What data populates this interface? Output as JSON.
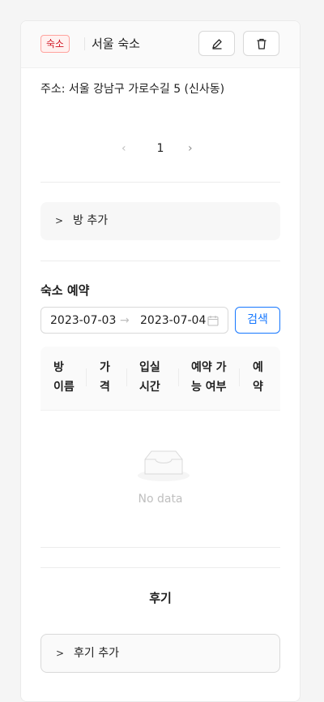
{
  "header": {
    "tag": "숙소",
    "title": "서울 숙소",
    "tag_colors": {
      "border": "#ffa39e",
      "background": "#fff1f0",
      "text": "#cf1322"
    },
    "icons": [
      "edit-icon",
      "delete-icon"
    ]
  },
  "address": "주소: 서울 강남구 가로수길 5 (신사동)",
  "pagination": {
    "prev": "‹",
    "current": "1",
    "next": "›"
  },
  "add_room": {
    "label": "방 추가",
    "chevron": ">"
  },
  "reservation": {
    "title": "숙소 예약",
    "start_date": "2023-07-03",
    "end_date": "2023-07-04",
    "separator": "→",
    "search_label": "검색",
    "accent": "#1677ff",
    "columns": [
      [
        "방",
        "이름"
      ],
      [
        "가",
        "격"
      ],
      [
        "입실",
        "시간"
      ],
      [
        "예약 가",
        "능 여부"
      ],
      [
        "예",
        "약"
      ]
    ],
    "empty_text": "No data"
  },
  "reviews": {
    "title": "후기",
    "add_label": "후기 추가",
    "chevron": ">"
  }
}
